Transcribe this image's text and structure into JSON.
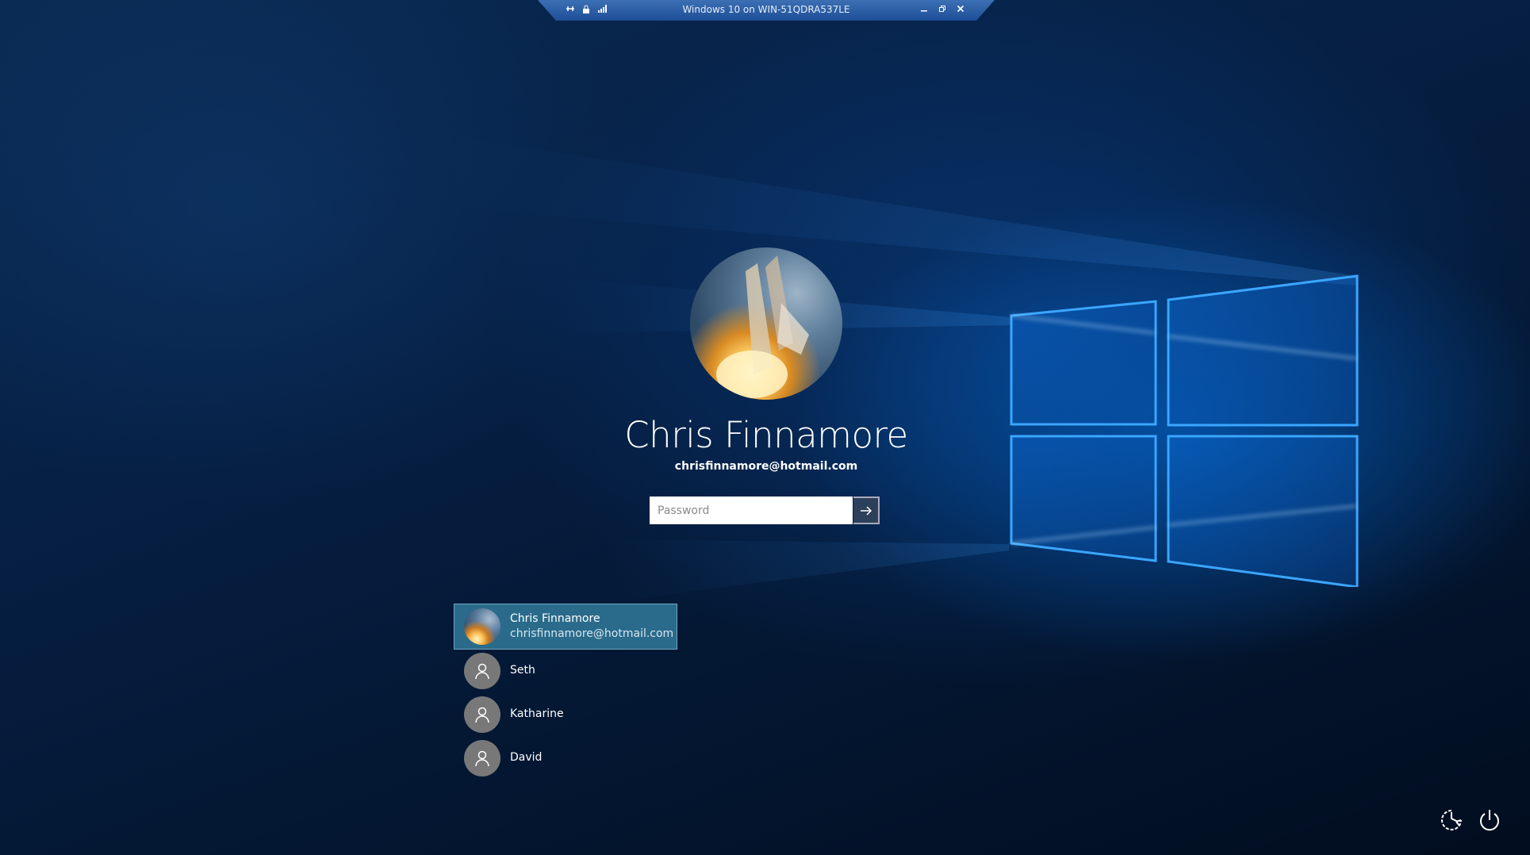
{
  "rdp_bar": {
    "title": "Windows 10 on WIN-51QDRA537LE",
    "icons": [
      "pin-icon",
      "lock-icon",
      "signal-icon"
    ],
    "controls": [
      "minimize-icon",
      "restore-icon",
      "close-icon"
    ]
  },
  "current_user": {
    "name": "Chris Finnamore",
    "email": "chrisfinnamore@hotmail.com"
  },
  "password": {
    "placeholder": "Password",
    "value": ""
  },
  "users": [
    {
      "name": "Chris Finnamore",
      "email": "chrisfinnamore@hotmail.com",
      "selected": true
    },
    {
      "name": "Seth"
    },
    {
      "name": "Katharine"
    },
    {
      "name": "David"
    }
  ],
  "corner_buttons": [
    "ease-of-access-icon",
    "power-icon"
  ],
  "colors": {
    "selected_user_bg": "#2a6b8b",
    "logo_glow": "#2f9bff"
  }
}
